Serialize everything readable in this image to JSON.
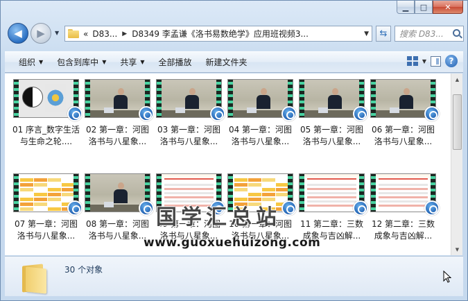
{
  "caption": {
    "minimize": "▁",
    "maximize": "□",
    "close": "✕"
  },
  "nav": {
    "back_icon": "arrow-left",
    "forward_icon": "arrow-right",
    "breadcrumb": [
      "«",
      "D83...",
      "D8349 李孟谦《洛书易数绝学》应用班视频3..."
    ],
    "search_placeholder": "搜索 D83..."
  },
  "toolbar": {
    "organize": "组织",
    "include_library": "包含到库中",
    "share": "共享",
    "play_all": "全部播放",
    "new_folder": "新建文件夹"
  },
  "files": [
    {
      "label": "01 序言_数字生活与生命之轮....",
      "thumb": "yinyang"
    },
    {
      "label": "02 第一章：河图洛书与八星象...",
      "thumb": "speaker"
    },
    {
      "label": "03 第一章：河图洛书与八星象...",
      "thumb": "speaker"
    },
    {
      "label": "04 第一章：河图洛书与八星象...",
      "thumb": "speaker"
    },
    {
      "label": "05 第一章：河图洛书与八星象...",
      "thumb": "speaker"
    },
    {
      "label": "06 第一章：河图洛书与八星象...",
      "thumb": "speaker"
    },
    {
      "label": "07 第一章：河图洛书与八星象...",
      "thumb": "table"
    },
    {
      "label": "08 第一章：河图洛书与八星象...",
      "thumb": "speaker"
    },
    {
      "label": "09 第一章：河图洛书与八星象...",
      "thumb": "slide"
    },
    {
      "label": "10 第一章：河图洛书与八星象...",
      "thumb": "table"
    },
    {
      "label": "11 第二章：三数成象与吉凶解...",
      "thumb": "slide"
    },
    {
      "label": "12 第二章：三数成象与吉凶解...",
      "thumb": "slide"
    }
  ],
  "watermark": {
    "cn": "国学汇总站",
    "url": "www.guoxuehuizong.com"
  },
  "status": {
    "count": "30 个对象"
  },
  "colors": {
    "reel_accent": "#48d2a0",
    "badge_blue": "#1f5fb0",
    "folder_yellow": "#f3d37a"
  }
}
